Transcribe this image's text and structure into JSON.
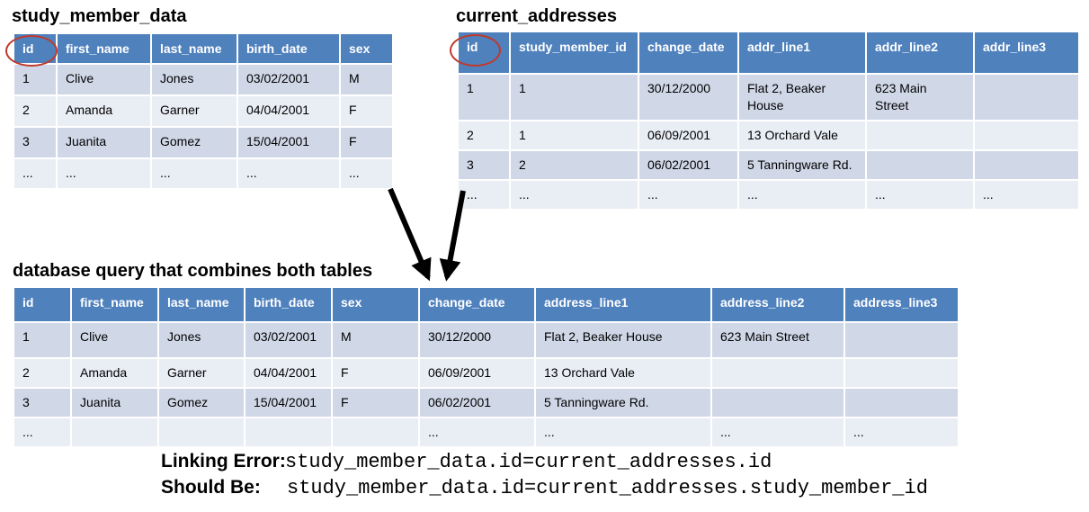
{
  "study_member_data": {
    "title": "study_member_data",
    "headers": [
      "id",
      "first_name",
      "last_name",
      "birth_date",
      "sex"
    ],
    "rows": [
      [
        "1",
        "Clive",
        "Jones",
        "03/02/2001",
        "M"
      ],
      [
        "2",
        "Amanda",
        "Garner",
        "04/04/2001",
        "F"
      ],
      [
        "3",
        "Juanita",
        "Gomez",
        "15/04/2001",
        "F"
      ],
      [
        "...",
        "...",
        "...",
        "...",
        "..."
      ]
    ]
  },
  "current_addresses": {
    "title": "current_addresses",
    "headers": [
      "id",
      "study_member_id",
      "change_date",
      "addr_line1",
      "addr_line2",
      "addr_line3"
    ],
    "rows": [
      [
        "1",
        "1",
        "30/12/2000",
        "Flat 2, Beaker House",
        "623 Main Street",
        ""
      ],
      [
        "2",
        "1",
        "06/09/2001",
        "13 Orchard Vale",
        "",
        ""
      ],
      [
        "3",
        "2",
        "06/02/2001",
        "5 Tanningware Rd.",
        "",
        ""
      ],
      [
        "...",
        "...",
        "...",
        "...",
        "...",
        "..."
      ]
    ]
  },
  "combined_query": {
    "title": "database query that combines both tables",
    "headers": [
      "id",
      "first_name",
      "last_name",
      "birth_date",
      "sex",
      "change_date",
      "address_line1",
      "address_line2",
      "address_line3"
    ],
    "rows": [
      [
        "1",
        "Clive",
        "Jones",
        "03/02/2001",
        "M",
        "30/12/2000",
        "Flat 2, Beaker House",
        "623 Main Street",
        ""
      ],
      [
        "2",
        "Amanda",
        "Garner",
        "04/04/2001",
        "F",
        "06/09/2001",
        "13 Orchard Vale",
        "",
        ""
      ],
      [
        "3",
        "Juanita",
        "Gomez",
        "15/04/2001",
        "F",
        "06/02/2001",
        "5 Tanningware Rd.",
        "",
        ""
      ],
      [
        "...",
        "",
        "",
        "",
        "",
        "...",
        "...",
        "...",
        "..."
      ]
    ]
  },
  "footer": {
    "error_label": "Linking Error:",
    "error_code": "study_member_data.id=current_addresses.id",
    "correct_label": "Should Be:",
    "correct_code": "study_member_data.id=current_addresses.study_member_id"
  },
  "colors": {
    "header": "#4f81bd",
    "row_odd": "#d0d8e8",
    "row_even": "#e9edf4",
    "highlight_ring": "#c0392b",
    "arrow": "#000000"
  }
}
